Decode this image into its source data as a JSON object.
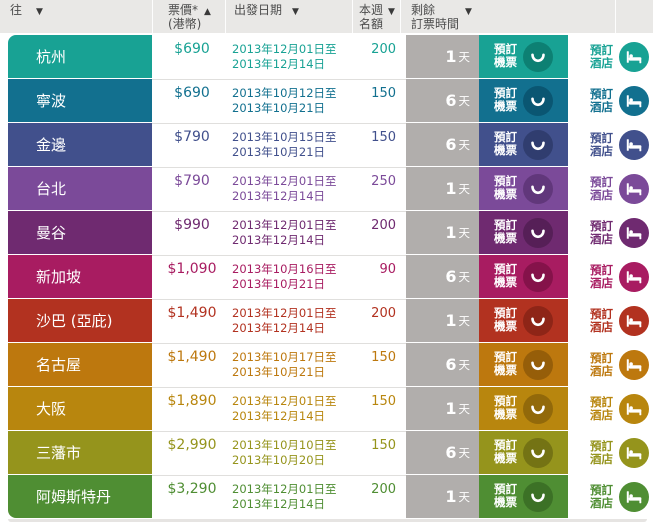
{
  "table": {
    "headers": {
      "destination": "往",
      "price_line1": "票價*",
      "price_line2": "(港幣)",
      "departure": "出發日期",
      "quota_line1": "本週",
      "quota_line2": "名額",
      "remaining_line1": "剩餘",
      "remaining_line2": "訂票時間",
      "sort_desc_icon": "▼",
      "sort_asc_icon": "▲"
    },
    "buttons": {
      "flight_line1": "預訂",
      "flight_line2": "機票",
      "hotel_line1": "預訂",
      "hotel_line2": "酒店"
    },
    "days_unit": "天",
    "colors": {
      "header_bg": "#e9e8e6",
      "days_cell_bg": "#b1aeac",
      "header_text": "#4c4c4c"
    },
    "rows": [
      {
        "destination": "杭州",
        "price": "$690",
        "date_from": "2013年12月01日至",
        "date_to": "2013年12月14日",
        "quota": "200",
        "days": "1",
        "color": "#18a294",
        "dark": "#0d8073"
      },
      {
        "destination": "寧波",
        "price": "$690",
        "date_from": "2013年10月12日至",
        "date_to": "2013年10月21日",
        "quota": "150",
        "days": "6",
        "color": "#12708f",
        "dark": "#0a5672"
      },
      {
        "destination": "金邊",
        "price": "$790",
        "date_from": "2013年10月15日至",
        "date_to": "2013年10月21日",
        "quota": "150",
        "days": "6",
        "color": "#41508c",
        "dark": "#303d6f"
      },
      {
        "destination": "台北",
        "price": "$790",
        "date_from": "2013年12月01日至",
        "date_to": "2013年12月14日",
        "quota": "250",
        "days": "1",
        "color": "#7b4a99",
        "dark": "#61377b"
      },
      {
        "destination": "曼谷",
        "price": "$990",
        "date_from": "2013年12月01日至",
        "date_to": "2013年12月14日",
        "quota": "200",
        "days": "1",
        "color": "#6f2a70",
        "dark": "#561f57"
      },
      {
        "destination": "新加坡",
        "price": "$1,090",
        "date_from": "2013年10月16日至",
        "date_to": "2013年10月21日",
        "quota": "90",
        "days": "6",
        "color": "#a81c61",
        "dark": "#85124a"
      },
      {
        "destination": "沙巴 (亞庇)",
        "price": "$1,490",
        "date_from": "2013年12月01日至",
        "date_to": "2013年12月14日",
        "quota": "200",
        "days": "1",
        "color": "#b23220",
        "dark": "#8e2517"
      },
      {
        "destination": "名古屋",
        "price": "$1,490",
        "date_from": "2013年10月17日至",
        "date_to": "2013年10月21日",
        "quota": "150",
        "days": "6",
        "color": "#bd780e",
        "dark": "#965e09"
      },
      {
        "destination": "大阪",
        "price": "$1,890",
        "date_from": "2013年12月01日至",
        "date_to": "2013年12月14日",
        "quota": "150",
        "days": "1",
        "color": "#b8860e",
        "dark": "#92690a"
      },
      {
        "destination": "三藩市",
        "price": "$2,990",
        "date_from": "2013年10月10日至",
        "date_to": "2013年10月20日",
        "quota": "150",
        "days": "6",
        "color": "#95941c",
        "dark": "#747314"
      },
      {
        "destination": "阿姆斯特丹",
        "price": "$3,290",
        "date_from": "2013年12月01日至",
        "date_to": "2013年12月14日",
        "quota": "200",
        "days": "1",
        "color": "#4f8e33",
        "dark": "#3c7126"
      }
    ]
  }
}
